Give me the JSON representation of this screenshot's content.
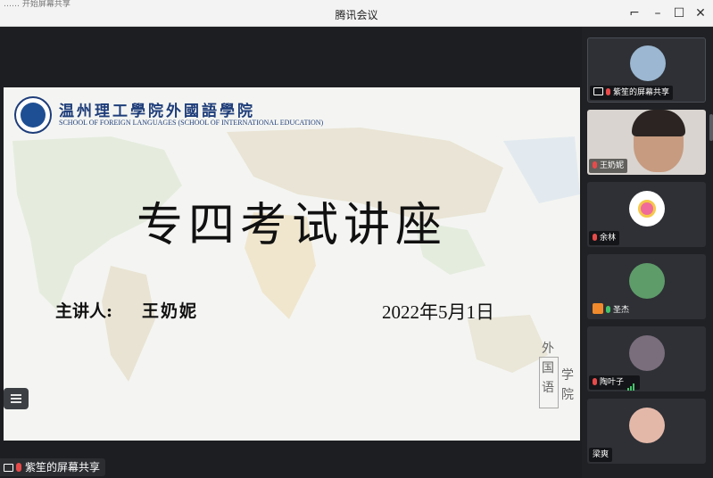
{
  "window": {
    "title": "腾讯会议",
    "background_title_fragment": "…… 开始屏幕共享"
  },
  "colors": {
    "titlebar_bg": "#f3f3f3",
    "stage_bg": "#1d1e21",
    "panel_bg": "#202125",
    "slide_blue": "#1e3d7a",
    "mic_green": "#45c36b",
    "mic_red": "#e84a4a"
  },
  "icons": {
    "minimize": "minimize-icon",
    "maximize": "maximize-icon",
    "close": "close-icon",
    "screen_share": "screen-share-icon",
    "mic": "microphone-icon",
    "menu": "list-menu-icon"
  },
  "slide": {
    "school_cn": "温州理工學院外國語學院",
    "school_en": "SCHOOL OF FOREIGN LANGUAGES (SCHOOL OF INTERNATIONAL EDUCATION)",
    "title": "专四考试讲座",
    "speaker_label": "主讲人:",
    "speaker_name": "王奶妮",
    "date": "2022年5月1日",
    "seal_chars": [
      "外",
      "国",
      "语",
      "学",
      "院"
    ]
  },
  "share_label": "紫笙的屏幕共享",
  "participants": [
    {
      "label": "紫笙的屏幕共享",
      "kind": "screen-share",
      "mic": "off"
    },
    {
      "label": "王奶妮",
      "kind": "video",
      "mic": "off"
    },
    {
      "label": "余林",
      "kind": "avatar",
      "mic": "off"
    },
    {
      "label": "圣杰",
      "kind": "avatar",
      "mic": "on"
    },
    {
      "label": "陶叶子",
      "kind": "avatar",
      "mic": "off",
      "speaking": true
    },
    {
      "label": "梁爽",
      "kind": "avatar",
      "mic": "none"
    }
  ]
}
